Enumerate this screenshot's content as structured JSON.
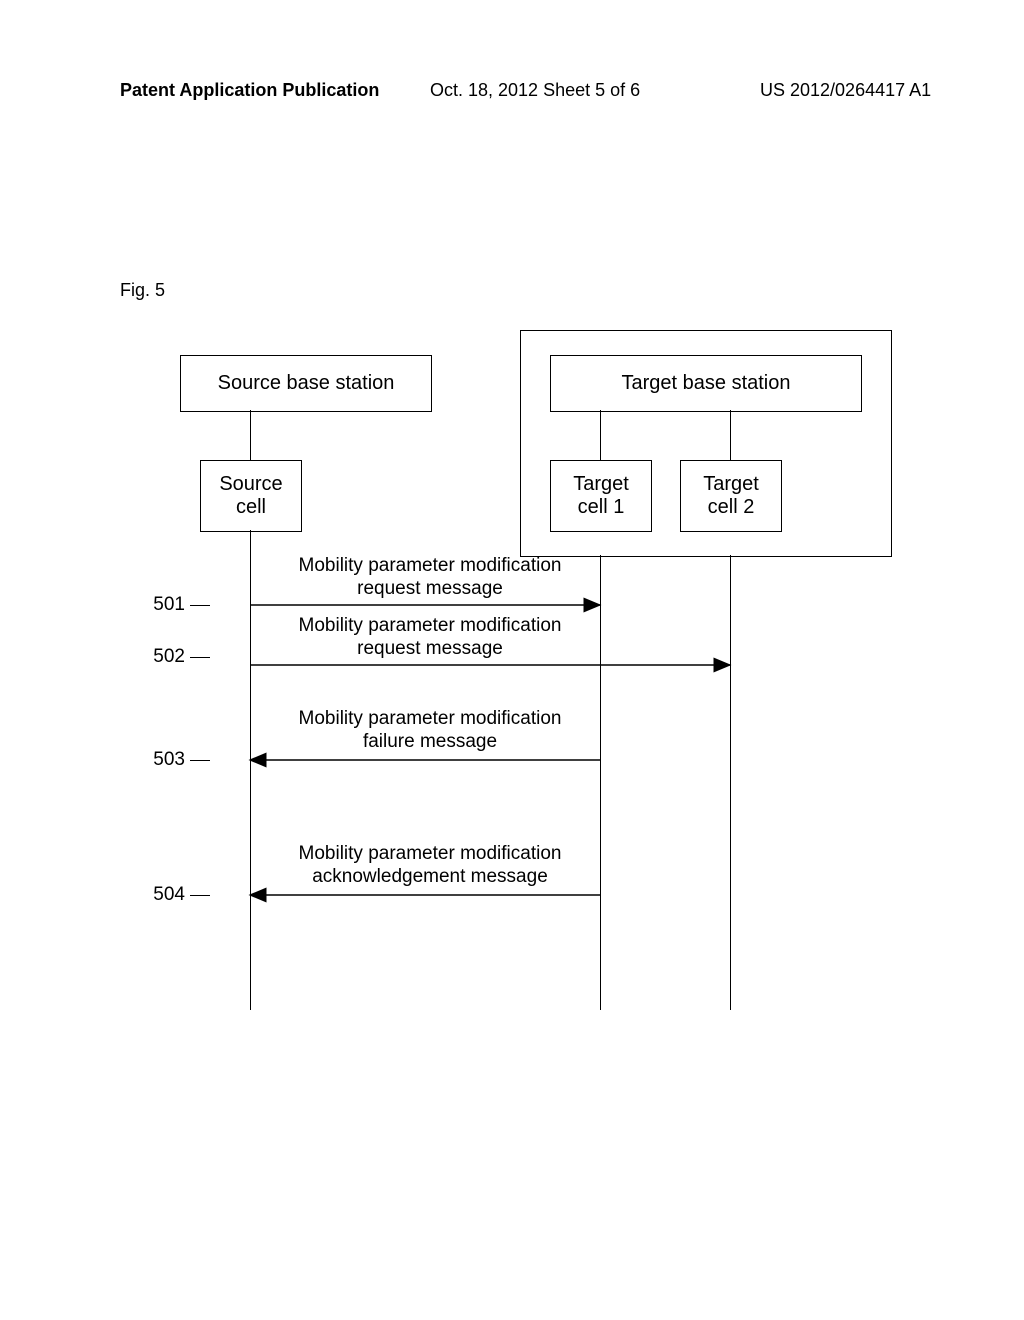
{
  "header": {
    "left": "Patent Application Publication",
    "center": "Oct. 18, 2012  Sheet 5 of 6",
    "right": "US 2012/0264417 A1"
  },
  "figure_label": "Fig. 5",
  "boxes": {
    "source_bs": "Source base station",
    "target_bs": "Target base station",
    "source_cell": "Source\ncell",
    "target_cell1": "Target\ncell 1",
    "target_cell2": "Target\ncell 2"
  },
  "steps": {
    "s501": {
      "num": "501",
      "label": "Mobility parameter modification\nrequest message"
    },
    "s502": {
      "num": "502",
      "label": "Mobility parameter modification\nrequest message"
    },
    "s503": {
      "num": "503",
      "label": "Mobility parameter modification\nfailure message"
    },
    "s504": {
      "num": "504",
      "label": "Mobility parameter modification\nacknowledgement message"
    }
  }
}
